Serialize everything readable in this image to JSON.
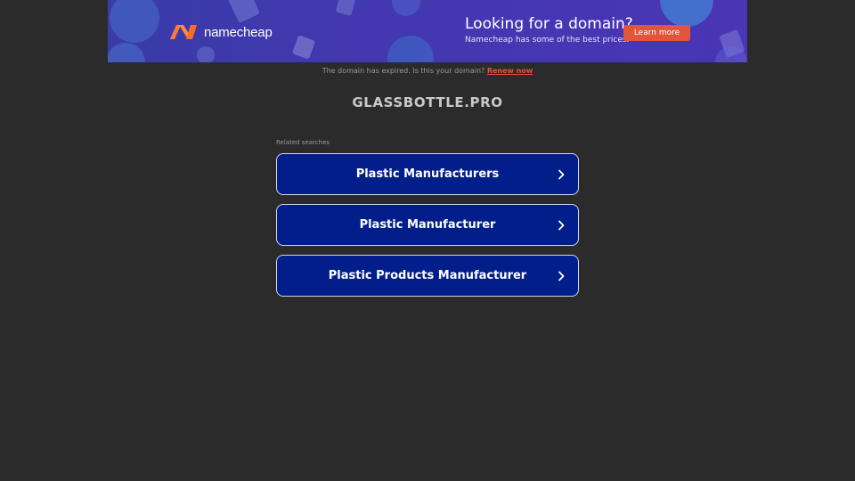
{
  "banner": {
    "brand": "namecheap",
    "title": "Looking for a domain?",
    "subtitle": "Namecheap has some of the best prices.",
    "cta_label": "Learn more",
    "accent": "#e4543a"
  },
  "notice": {
    "text": "The domain has expired. Is this your domain?",
    "link_label": "Renew now"
  },
  "domain": "GLASSBOTTLE.PRO",
  "related": {
    "label": "Related searches",
    "items": [
      {
        "label": "Plastic Manufacturers",
        "icon": "chevron-right-icon"
      },
      {
        "label": "Plastic Manufacturer",
        "icon": "chevron-right-icon"
      },
      {
        "label": "Plastic Products Manufacturer",
        "icon": "chevron-right-icon"
      }
    ]
  }
}
